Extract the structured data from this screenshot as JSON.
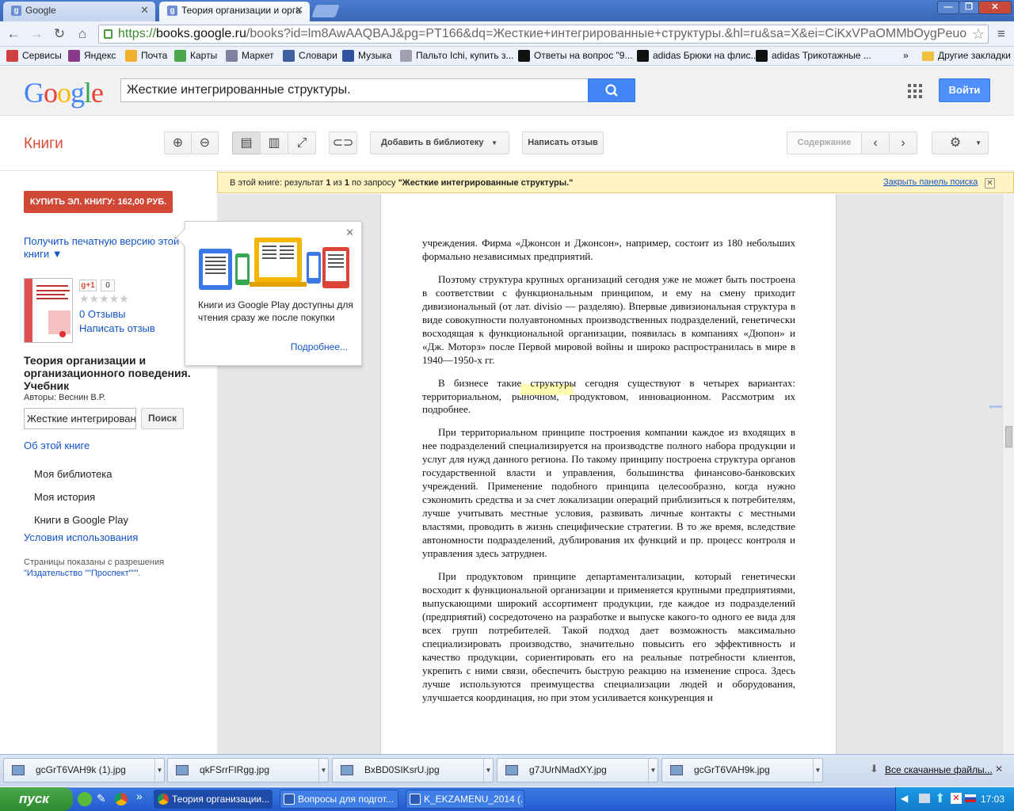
{
  "browser": {
    "tabs": [
      {
        "label": "Google"
      },
      {
        "label": "Теория организации и орга"
      }
    ],
    "url": {
      "scheme": "https://",
      "host": "books.google.ru",
      "rest": "/books?id=lm8AwAAQBAJ&pg=PT166&dq=Жесткие+интегрированные+структуры.&hl=ru&sa=X&ei=CiKxVPaOMMbOygPeuo"
    },
    "bookmarks": [
      {
        "label": "Сервисы",
        "icon": "apps-icon",
        "color": "#d04040"
      },
      {
        "label": "Яндекс",
        "icon": "yandex-icon",
        "color": "#8a3a8a"
      },
      {
        "label": "Почта",
        "icon": "mail-icon",
        "color": "#f0b030"
      },
      {
        "label": "Карты",
        "icon": "maps-icon",
        "color": "#4aa84a"
      },
      {
        "label": "Маркет",
        "icon": "market-icon",
        "color": "#8080a0"
      },
      {
        "label": "Словари",
        "icon": "dictionary-icon",
        "color": "#4060a0"
      },
      {
        "label": "Музыка",
        "icon": "music-icon",
        "color": "#3050a0"
      },
      {
        "label": "Пальто Ichi, купить з...",
        "icon": "lamoda-icon",
        "color": "#a0a0b0"
      },
      {
        "label": "Ответы на вопрос \"9...",
        "icon": "k-icon",
        "color": "#111111"
      },
      {
        "label": "adidas Брюки на флис...",
        "icon": "adidas-icon",
        "color": "#111111"
      },
      {
        "label": "adidas Трикотажные ...",
        "icon": "adidas-icon",
        "color": "#111111"
      }
    ],
    "bookmarks_more": "»",
    "other_bookmarks": "Другие закладки"
  },
  "google": {
    "logo_letters": [
      {
        "ch": "G",
        "color": "#4285f4"
      },
      {
        "ch": "o",
        "color": "#ea4335"
      },
      {
        "ch": "o",
        "color": "#fbbc05"
      },
      {
        "ch": "g",
        "color": "#4285f4"
      },
      {
        "ch": "l",
        "color": "#34a853"
      },
      {
        "ch": "e",
        "color": "#ea4335"
      }
    ],
    "search_value": "Жесткие интегрированные структуры.",
    "login": "Войти"
  },
  "books_toolbar": {
    "section": "Книги",
    "add_library": "Добавить в библиотеку",
    "write_review": "Написать отзыв",
    "contents": "Содержание"
  },
  "left": {
    "buy": "КУПИТЬ ЭЛ. КНИГУ: 162,00 РУБ.",
    "print_version": "Получить печатную версию этой книги ▼",
    "gplus": "g+1",
    "gplus_count": "0",
    "stars": "★★★★★",
    "rating": 0,
    "reviews": "0 Отзывы",
    "write_review": "Написать отзыв",
    "book_title": "Теория организации и организационного поведения. Учебник",
    "author": "Авторы: Веснин В.Р.",
    "in_search": "Жесткие интегрированные структуры.",
    "in_search_btn": "Поиск",
    "about": "Об этой книге",
    "nav": [
      "Моя библиотека",
      "Моя история",
      "Книги в Google Play"
    ],
    "terms": "Условия использования",
    "permission": "Страницы показаны с разрешения",
    "publisher": "\"Издательство \"\"Проспект\"\"\"."
  },
  "popup": {
    "text": "Книги из Google Play доступны для чтения сразу же после покупки",
    "more": "Подробнее..."
  },
  "resultbar": {
    "prefix": "В этой книге: результат",
    "n": "1",
    "of": "из",
    "total": "1",
    "query_label": "по запросу",
    "query": "\"Жесткие интегрированные структуры.\"",
    "close": "Закрыть панель поиска"
  },
  "page_text": [
    "учреждения. Фирма «Джонсон и Джонсон», например, состоит из 180 небольших формально независимых предприятий.",
    "Поэтому структура крупных организаций сегодня уже не может быть построена в соответствии с функциональным принципом, и ему на смену приходит дивизиональный (от лат. divisio — разделяю). Впервые дивизиональная структура в виде совокупности полуавтономных производственных подразделений, генетически восходящая к функциональной организации, появилась в компаниях «Дюпон» и «Дж. Моторз» после Первой мировой войны и широко распространилась в мире в 1940—1950-х гг.",
    "В бизнесе такие структуры сегодня существуют в четырех вариантах: территориальном, рыночном, продуктовом, инновационном. Рассмотрим их подробнее.",
    "При территориальном принципе построения компании каждое из входящих в нее подразделений специализируется на производстве полного набора продукции и услуг для нужд данного региона. По такому принципу построена структура органов государственной власти и управления, большинства финансово-банковских учреждений. Применение подобного принципа целесообразно, когда нужно сэкономить средства и за счет локализации операций приблизиться к потребителям, лучше учитывать местные условия, развивать личные контакты с местными властями, проводить в жизнь специфические стратегии. В то же время, вследствие автономности подразделений, дублирования их функций и пр. процесс контроля и управления здесь затруднен.",
    "При продуктовом принципе департаментализации, который генетически восходит к функциональной организации и применяется крупными предприятиями, выпускающими широкий ассортимент продукции, где каждое из подразделений (предприятий) сосредоточено на разработке и выпуске какого-то одного ее вида для всех групп потребителей. Такой подход дает возможность максимально специализировать производство, значительно повысить его эффективность и качество продукции, сориентировать его на реальные потребности клиентов, укрепить с ними связи, обеспечить быструю реакцию на изменение спроса. Здесь лучше используются преимущества специализации людей и оборудования, улучшается координация, но при этом усиливается конкуренция и"
  ],
  "downloads": {
    "files": [
      "gcGrT6VAH9k (1).jpg",
      "qkFSrrFIRgg.jpg",
      "BxBD0SIKsrU.jpg",
      "g7JUrNMadXY.jpg",
      "gcGrT6VAH9k.jpg"
    ],
    "all": "Все скачанные файлы..."
  },
  "taskbar": {
    "start": "пуск",
    "tasks": [
      "Теория организации...",
      "Вопросы для подгот...",
      "K_EKZAMENU_2014 (..."
    ],
    "time": "17:03"
  }
}
